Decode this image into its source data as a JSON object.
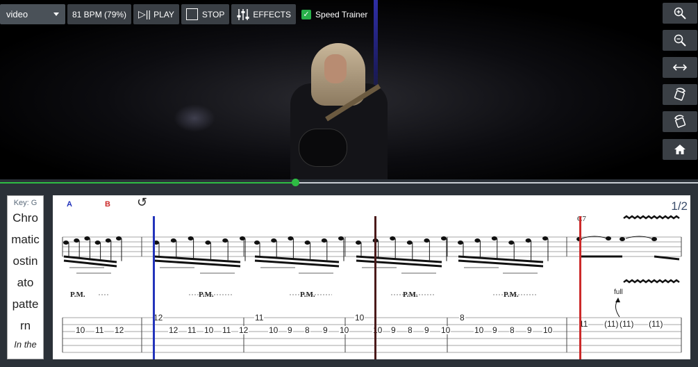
{
  "toolbar": {
    "source_select": "video",
    "tempo": "81 BPM (79%)",
    "play_label": "PLAY",
    "stop_label": "STOP",
    "effects_label": "EFFECTS",
    "speed_trainer_label": "Speed Trainer",
    "speed_trainer_checked": true
  },
  "side_tools": [
    "zoom-in-icon",
    "zoom-out-icon",
    "fit-width-icon",
    "rotate-right-icon",
    "rotate-left-icon",
    "home-icon"
  ],
  "progress": {
    "fraction": 0.423,
    "color": "#2ebd44"
  },
  "info_card": {
    "key": "Key: G",
    "title_lines": [
      "Chro",
      "matic",
      "ostin",
      "ato",
      "patte",
      "rn"
    ],
    "subtitle": "In the"
  },
  "score": {
    "loop_a": "A",
    "loop_b": "B",
    "page": "1/2",
    "chord": "C7",
    "bend_label": "full",
    "palm_mute": "P.M.",
    "tuplet": "3",
    "tab_numbers": [
      "10",
      "11",
      "12",
      "12",
      "12",
      "11",
      "10",
      "11",
      "12",
      "11",
      "10",
      "9",
      "8",
      "9",
      "10",
      "10",
      "10",
      "9",
      "8",
      "9",
      "10",
      "8",
      "10",
      "9",
      "8",
      "9",
      "10",
      "11",
      "(11)",
      "(11)",
      "(11)"
    ],
    "colors": {
      "loop_a": "#2233bb",
      "loop_b": "#cc2a2a",
      "cursor": "#4a1a1a"
    }
  }
}
